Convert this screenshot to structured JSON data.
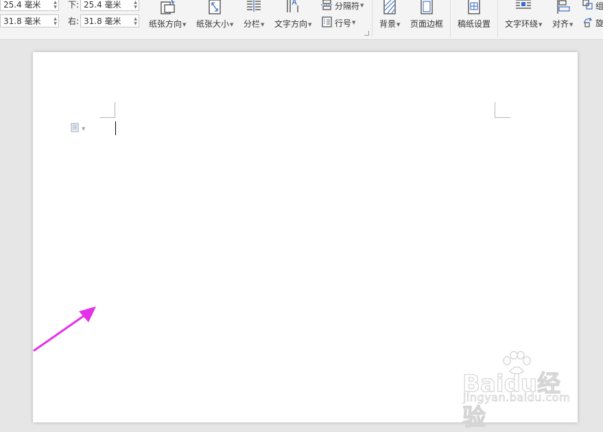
{
  "margins": {
    "top_value": "25.4 毫米",
    "left_value": "31.8 毫米",
    "bottom_label": "下:",
    "bottom_value": "25.4 毫米",
    "right_label": "右:",
    "right_value": "31.8 毫米"
  },
  "toolbar": {
    "orientation_label": "纸张方向",
    "size_label": "纸张大小",
    "columns_label": "分栏",
    "text_direction_label": "文字方向",
    "breaks_label": "分隔符",
    "line_numbers_label": "行号",
    "background_label": "背景",
    "page_borders_label": "页面边框",
    "manuscript_label": "稿纸设置",
    "text_wrap_label": "文字环绕",
    "align_label": "对齐",
    "group_label": "组",
    "rotate_label": "旋"
  },
  "watermark": {
    "brand": "Baidu经验",
    "url": "jingyan.baidu.com"
  },
  "colors": {
    "accent_icon": "#3c6cc4",
    "arrow": "#e52fe8",
    "ribbon_bg": "#f4f4f4",
    "workspace_bg": "#e6e6e6"
  },
  "icons": [
    "page-orientation-icon",
    "paper-size-icon",
    "columns-icon",
    "text-direction-icon",
    "breaks-icon",
    "line-numbers-icon",
    "background-icon",
    "page-borders-icon",
    "manuscript-icon",
    "text-wrap-icon",
    "align-icon",
    "group-icon",
    "rotate-icon",
    "paragraph-icon"
  ]
}
